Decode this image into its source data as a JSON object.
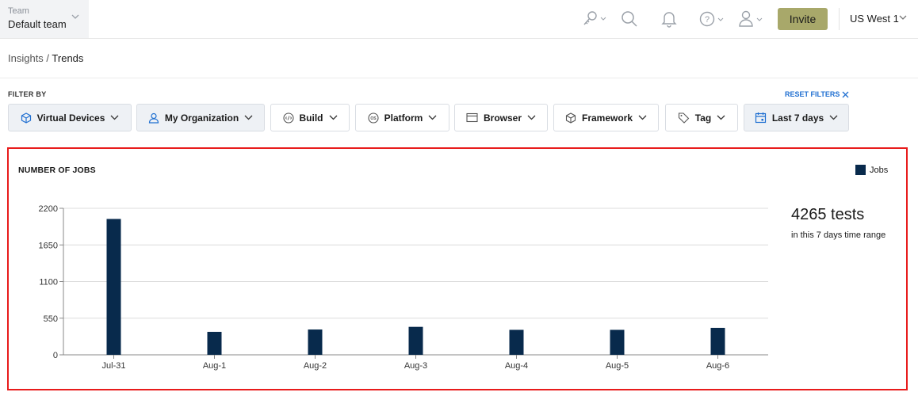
{
  "header": {
    "team_label": "Team",
    "team_value": "Default team",
    "icons": [
      "key-icon",
      "search-icon",
      "bell-icon",
      "help-icon",
      "user-icon"
    ],
    "invite_label": "Invite",
    "region": "US West 1"
  },
  "breadcrumb": {
    "parent": "Insights",
    "separator": " / ",
    "current": "Trends"
  },
  "filters": {
    "title": "FILTER BY",
    "reset_label": "RESET FILTERS",
    "items": [
      {
        "label": "Virtual Devices",
        "icon": "cube-icon"
      },
      {
        "label": "My Organization",
        "icon": "user-icon"
      },
      {
        "label": "Build",
        "icon": "build-icon"
      },
      {
        "label": "Platform",
        "icon": "os-icon"
      },
      {
        "label": "Browser",
        "icon": "browser-icon"
      },
      {
        "label": "Framework",
        "icon": "framework-icon"
      },
      {
        "label": "Tag",
        "icon": "tag-icon"
      },
      {
        "label": "Last 7 days",
        "icon": "calendar-icon"
      }
    ]
  },
  "panel": {
    "title": "NUMBER OF JOBS",
    "total": "4265 tests",
    "total_caption": "in this 7 days time range"
  },
  "colors": {
    "accent": "#a8a86a",
    "bar": "#082a4c",
    "highlight_border": "#e81c1c",
    "link": "#1f6fd1"
  },
  "chart_data": {
    "type": "bar",
    "title": "NUMBER OF JOBS",
    "xlabel": "",
    "ylabel": "",
    "categories": [
      "Jul-31",
      "Aug-1",
      "Aug-2",
      "Aug-3",
      "Aug-4",
      "Aug-5",
      "Aug-6"
    ],
    "series": [
      {
        "name": "Jobs",
        "values": [
          2040,
          345,
          380,
          420,
          375,
          375,
          405
        ]
      }
    ],
    "yticks": [
      0,
      550,
      1100,
      1650,
      2200
    ],
    "ylim": [
      0,
      2200
    ],
    "grid": true,
    "legend": "top-right"
  }
}
